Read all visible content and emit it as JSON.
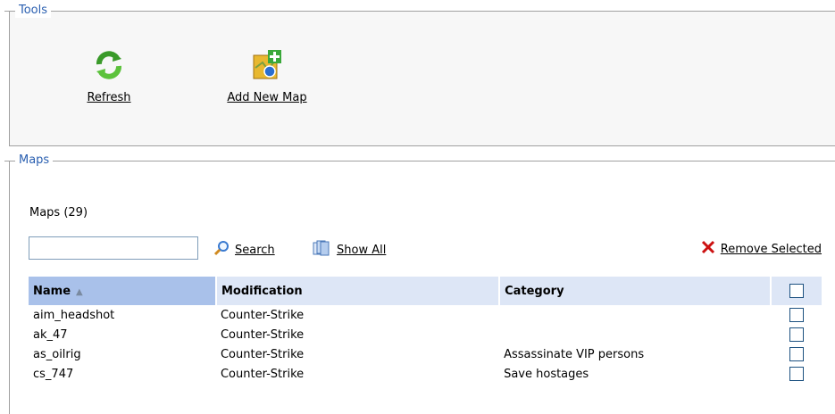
{
  "tools": {
    "legend": "Tools",
    "refresh_label": "Refresh",
    "add_map_label": "Add New Map"
  },
  "maps": {
    "legend": "Maps",
    "count_label": "Maps (29)",
    "search": {
      "value": "",
      "placeholder": ""
    },
    "search_label": "Search",
    "show_all_label": "Show All",
    "remove_selected_label": "Remove Selected",
    "columns": {
      "name": "Name",
      "modification": "Modification",
      "category": "Category"
    },
    "sort_indicator": "▲",
    "rows": [
      {
        "name": "aim_headshot",
        "modification": "Counter-Strike",
        "category": ""
      },
      {
        "name": "ak_47",
        "modification": "Counter-Strike",
        "category": ""
      },
      {
        "name": "as_oilrig",
        "modification": "Counter-Strike",
        "category": "Assassinate VIP persons"
      },
      {
        "name": "cs_747",
        "modification": "Counter-Strike",
        "category": "Save hostages"
      }
    ]
  },
  "colors": {
    "legend_text": "#2a5fb0",
    "header_bg": "#dde6f6",
    "sorted_header_bg": "#a9c1ea",
    "remove_icon": "#cc1111"
  },
  "icons": {
    "refresh": "refresh-icon",
    "add_map": "add-map-icon",
    "search": "magnifier-icon",
    "show_all": "pages-icon",
    "remove": "red-x-icon"
  }
}
